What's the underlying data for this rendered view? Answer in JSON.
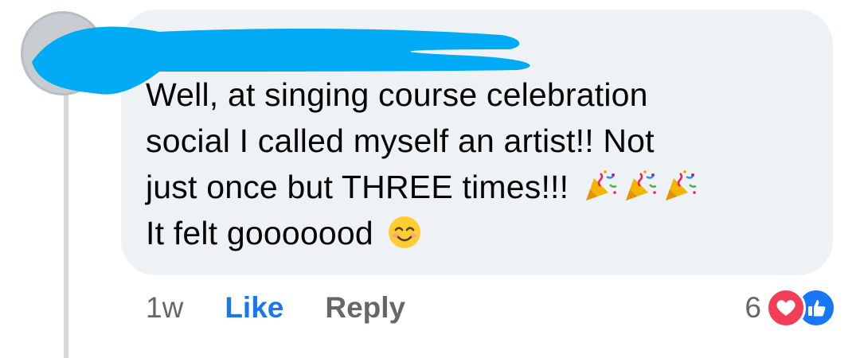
{
  "comment": {
    "lines": [
      "Well, at singing course celebration",
      "social I called myself an artist!! Not",
      "just once but THREE times!!!",
      "It felt gooooood"
    ],
    "line3_emojis": [
      "party-popper-icon",
      "party-popper-icon",
      "party-popper-icon"
    ],
    "line4_emoji": "smiling-face-icon"
  },
  "actions": {
    "time": "1w",
    "like_label": "Like",
    "reply_label": "Reply"
  },
  "reactions": {
    "count": "6",
    "icons": [
      "heart-icon",
      "thumbs-up-icon"
    ]
  },
  "colors": {
    "bubble_bg": "#eff2f5",
    "redaction": "#00aaf5",
    "like_blue": "#1877f2",
    "heart_red": "#f33e58",
    "muted_text": "#65676b"
  }
}
